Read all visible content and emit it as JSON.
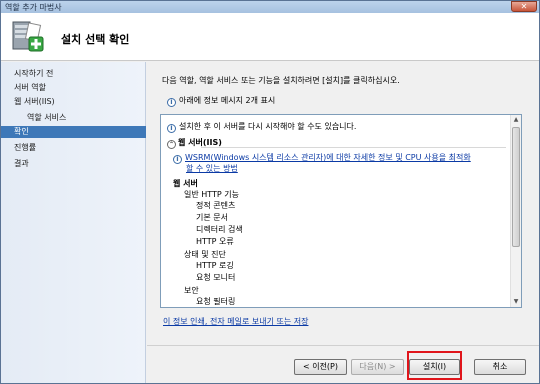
{
  "window": {
    "title": "역할 추가 마법사",
    "close_label": "✕"
  },
  "header": {
    "title": "설치 선택 확인"
  },
  "sidebar": {
    "steps": [
      {
        "label": "시작하기 전"
      },
      {
        "label": "서버 역할"
      },
      {
        "label": "웹 서버(IIS)"
      },
      {
        "label": "역할 서비스"
      },
      {
        "label": "확인"
      },
      {
        "label": "진행률"
      },
      {
        "label": "결과"
      }
    ]
  },
  "main": {
    "instruction": "다음 역할, 역할 서비스 또는 기능을 설치하려면 [설치]를 클릭하십시오.",
    "info_message": "아래에 정보 메시지 2개 표시",
    "results": {
      "restart_warning": "설치한 후 이 서버를 다시 시작해야 할 수도 있습니다.",
      "section_title": "웹 서버(IIS)",
      "wsrm_line1": "WSRM(Windows 시스템 리소스 관리자)에 대한 자세한 정보 및 CPU 사용을 최적화",
      "wsrm_line2": "할 수 있는 방법",
      "tree": [
        {
          "label": "웹 서버",
          "level": 0,
          "bold": true
        },
        {
          "label": "일반 HTTP 기능",
          "level": 1
        },
        {
          "label": "정적 콘텐츠",
          "level": 2
        },
        {
          "label": "기본 문서",
          "level": 2
        },
        {
          "label": "디렉터리 검색",
          "level": 2
        },
        {
          "label": "HTTP 오류",
          "level": 2
        },
        {
          "label": "상태 및 진단",
          "level": 1
        },
        {
          "label": "HTTP 로깅",
          "level": 2
        },
        {
          "label": "요청 모니터",
          "level": 2
        },
        {
          "label": "보안",
          "level": 1
        },
        {
          "label": "요청 필터링",
          "level": 2
        }
      ]
    },
    "print_link": "이 정보 인쇄, 전자 메일로 보내기 또는 저장"
  },
  "buttons": {
    "previous": "< 이전(P)",
    "next": "다음(N) >",
    "install": "설치(I)",
    "cancel": "취소"
  },
  "colors": {
    "active_step": "#3e78b8",
    "highlight": "#e0151b",
    "link": "#0b3aa5"
  }
}
